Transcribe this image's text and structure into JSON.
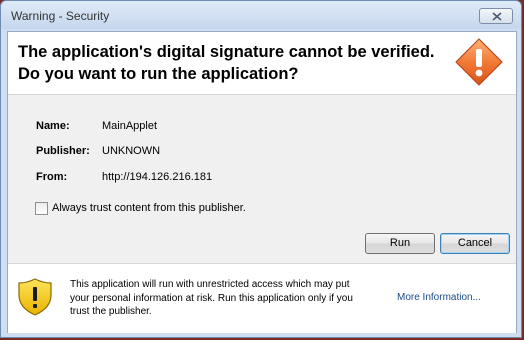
{
  "window": {
    "title": "Warning - Security",
    "headline_line1": "The application's digital signature cannot be verified.",
    "headline_line2": "Do you want to run the application?",
    "header_icon": "warning-diamond-icon"
  },
  "details": {
    "name_label": "Name:",
    "name_value": "MainApplet",
    "publisher_label": "Publisher:",
    "publisher_value": "UNKNOWN",
    "from_label": "From:",
    "from_value": "http://194.126.216.181"
  },
  "trust": {
    "checkbox_label": "Always trust content from this publisher.",
    "checked": false
  },
  "buttons": {
    "run": "Run",
    "cancel": "Cancel"
  },
  "footer": {
    "icon": "shield-warning-icon",
    "line1": "This application will run with unrestricted access which may put",
    "line2": "your personal information at risk. Run this application only if you",
    "line3": "trust the publisher.",
    "more_info": "More Information..."
  },
  "colors": {
    "warning_orange": "#e8641e",
    "shield_yellow": "#f5c400",
    "link_blue": "#1a4e8a"
  }
}
